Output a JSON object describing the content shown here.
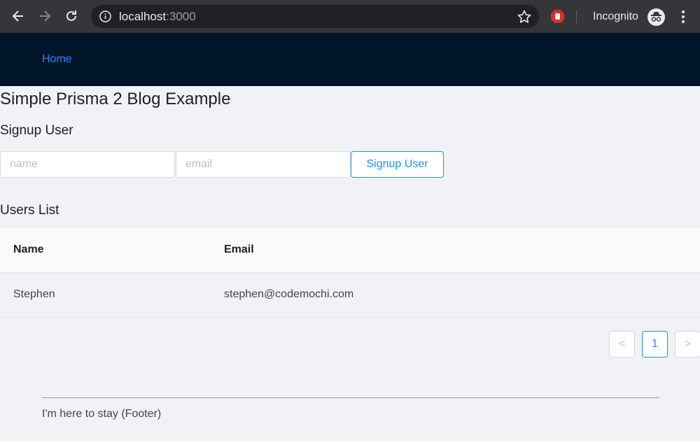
{
  "browser": {
    "url_host": "localhost",
    "url_port": ":3000",
    "profile_label": "Incognito"
  },
  "header": {
    "nav_home": "Home"
  },
  "page": {
    "title": "Simple Prisma 2 Blog Example"
  },
  "signup": {
    "heading": "Signup User",
    "name_placeholder": "name",
    "email_placeholder": "email",
    "button_label": "Signup User"
  },
  "users": {
    "heading": "Users List",
    "columns": [
      "Name",
      "Email"
    ],
    "rows": [
      {
        "name": "Stephen",
        "email": "stephen@codemochi.com"
      }
    ]
  },
  "pagination": {
    "prev": "<",
    "current_page": "1",
    "next": ">"
  },
  "footer": {
    "text": "I'm here to stay (Footer)"
  },
  "colors": {
    "header_bg": "#001529",
    "accent": "#1890ff",
    "page_bg": "#f0f2f5"
  }
}
